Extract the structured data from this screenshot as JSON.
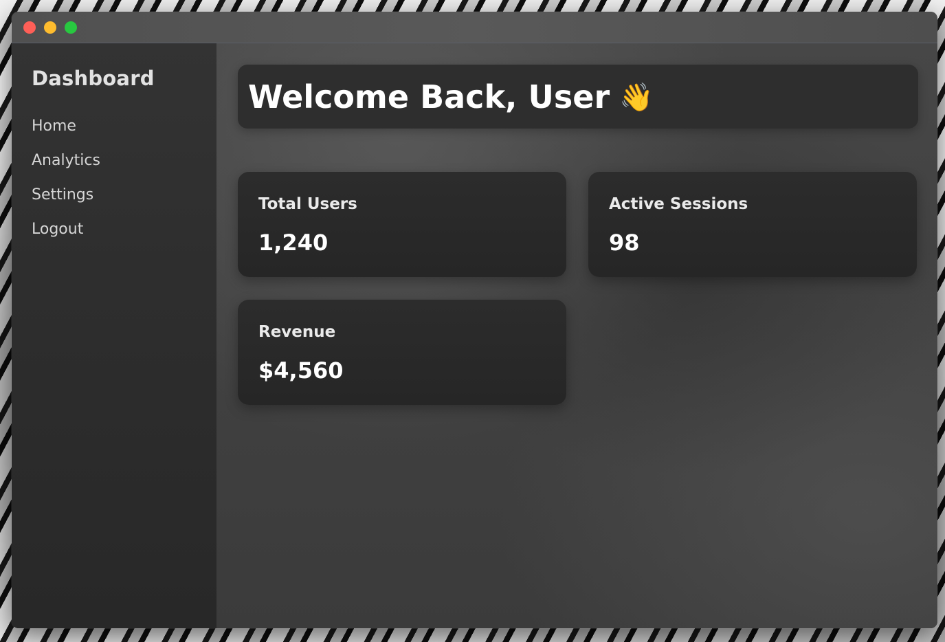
{
  "window": {
    "controls": {
      "close_color": "#ff5f57",
      "minimize_color": "#febc2e",
      "maximize_color": "#28c840"
    }
  },
  "sidebar": {
    "title": "Dashboard",
    "items": [
      {
        "label": "Home"
      },
      {
        "label": "Analytics"
      },
      {
        "label": "Settings"
      },
      {
        "label": "Logout"
      }
    ]
  },
  "main": {
    "welcome": {
      "text": "Welcome Back, User",
      "icon": "waving-hand-icon",
      "emoji": "👋"
    },
    "cards": [
      {
        "label": "Total Users",
        "value": "1,240"
      },
      {
        "label": "Active Sessions",
        "value": "98"
      },
      {
        "label": "Revenue",
        "value": "$4,560"
      }
    ]
  }
}
